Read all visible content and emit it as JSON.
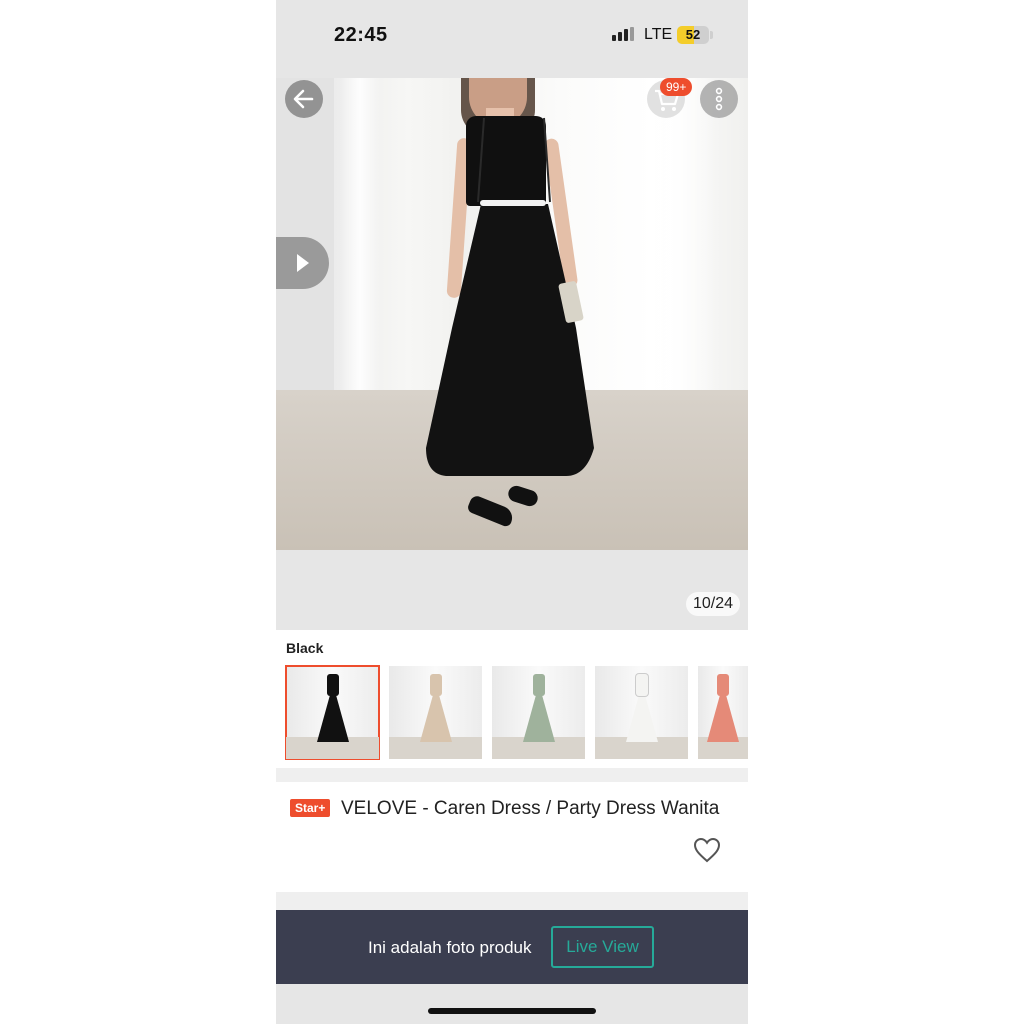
{
  "status_bar": {
    "time": "22:45",
    "network": "LTE",
    "battery": "52",
    "battery_level": 0.52
  },
  "gallery": {
    "counter": "10/24",
    "cart_badge": "99+",
    "icons": [
      "back-arrow-icon",
      "cart-icon",
      "more-vertical-icon",
      "play-icon"
    ]
  },
  "variants": {
    "selected_label": "Black",
    "thumbnails": [
      {
        "color": "#111111",
        "selected": true
      },
      {
        "color": "#d8c4ad",
        "selected": false
      },
      {
        "color": "#9fb29c",
        "selected": false
      },
      {
        "color": "#f4f4f2",
        "selected": false
      },
      {
        "color": "#e58a78",
        "selected": false
      }
    ]
  },
  "product": {
    "badge": "Star+",
    "title": "VELOVE - Caren Dress / Party Dress Wanita"
  },
  "banner": {
    "text": "Ini adalah foto produk",
    "button": "Live View"
  },
  "colors": {
    "accent": "#ee4d2d",
    "teal": "#26aa99",
    "banner_bg": "#3b3e50"
  }
}
